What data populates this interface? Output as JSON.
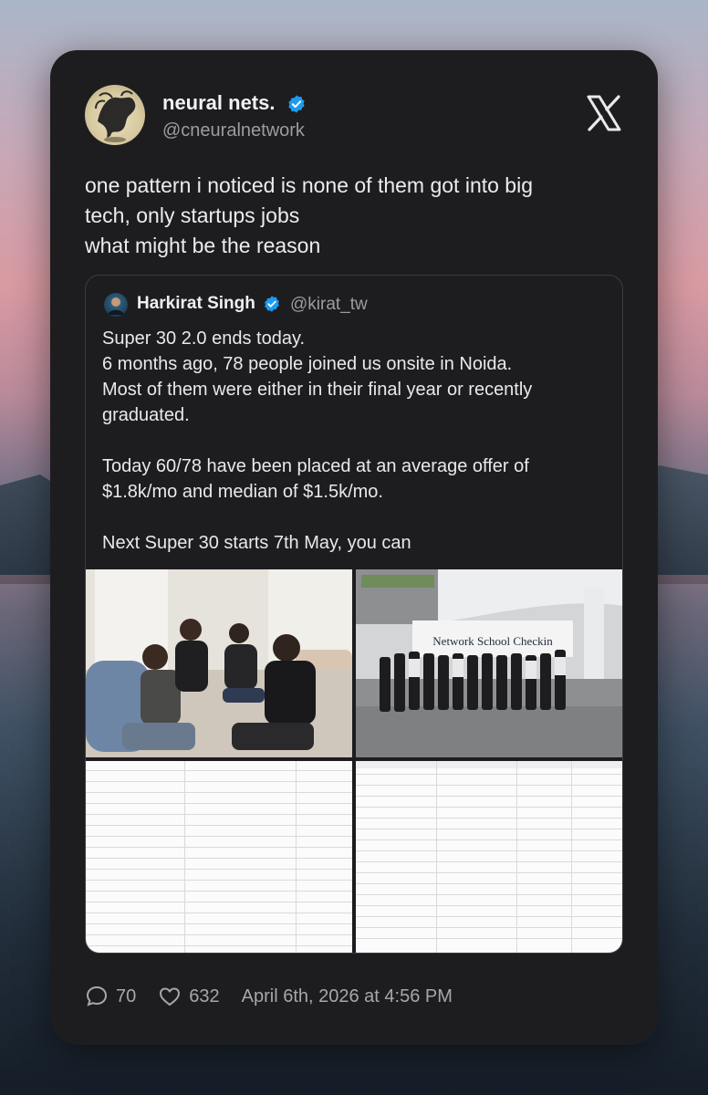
{
  "tweet": {
    "author_name": "neural nets.",
    "author_handle": "@cneuralnetwork",
    "text_lines": [
      "one pattern i noticed is none of them got into big",
      "tech, only startups jobs",
      "what might be the reason"
    ],
    "replies": "70",
    "likes": "632",
    "timestamp": "April 6th, 2026 at 4:56 PM"
  },
  "quoted": {
    "author_name": "Harkirat Singh",
    "author_handle": "@kirat_tw",
    "text_lines": [
      "Super 30 2.0 ends today.",
      "6 months ago, 78 people joined us onsite in Noida.",
      "Most of them were either in their final year or recently",
      "graduated.",
      "",
      "Today 60/78 have been placed at an average offer of",
      "$1.8k/mo and median of $1.5k/mo.",
      "",
      "Next Super 30 starts 7th May, you can"
    ],
    "banner_text": "Network School Checkin"
  },
  "icons": {
    "verified": "verified-badge-icon",
    "platform": "x-logo-icon",
    "reply": "reply-bubble-icon",
    "like": "heart-icon"
  },
  "colors": {
    "card_bg": "#1d1d20",
    "verified_blue": "#1d9bf0",
    "muted_text": "#9b9ba2"
  }
}
